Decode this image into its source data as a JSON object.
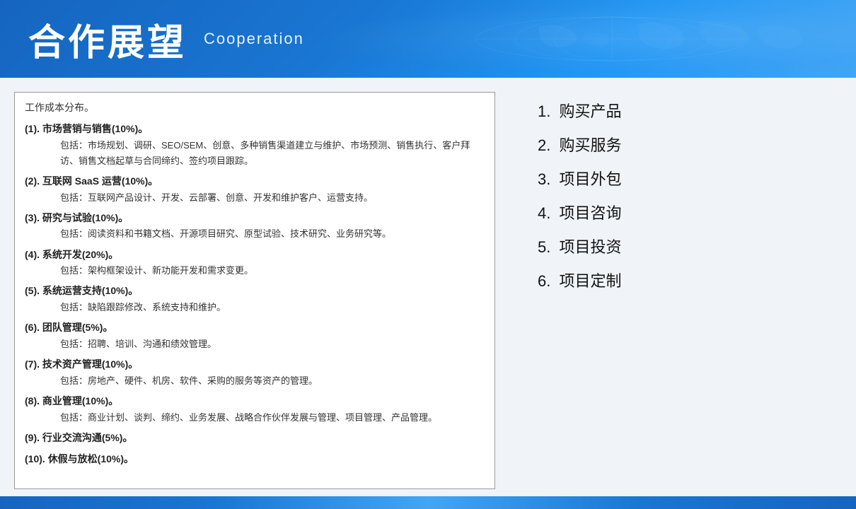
{
  "header": {
    "title_cn": "合作展望",
    "title_en": "Cooperation"
  },
  "content_box": {
    "header": "工作成本分布。",
    "sections": [
      {
        "id": "(1).",
        "title": "市场营销与销售(10%)。",
        "desc": "包括：市场规划、调研、SEO/SEM、创意、多种销售渠道建立与维护、市场预测、销售执行、客户拜访、销售文档起草与合同缔约、签约项目跟踪。"
      },
      {
        "id": "(2).",
        "title": "互联网 SaaS 运营(10%)。",
        "desc": "包括：互联网产品设计、开发、云部署、创意、开发和维护客户、运营支持。"
      },
      {
        "id": "(3).",
        "title": "研究与试验(10%)。",
        "desc": "包括：阅读资料和书籍文档、开源项目研究、原型试验、技术研究、业务研究等。"
      },
      {
        "id": "(4).",
        "title": "系统开发(20%)。",
        "desc": "包括：架构框架设计、新功能开发和需求变更。"
      },
      {
        "id": "(5).",
        "title": "系统运营支持(10%)。",
        "desc": "包括：缺陷跟踪修改、系统支持和维护。"
      },
      {
        "id": "(6).",
        "title": "团队管理(5%)。",
        "desc": "包括：招聘、培训、沟通和绩效管理。"
      },
      {
        "id": "(7).",
        "title": "技术资产管理(10%)。",
        "desc": "包括：房地产、硬件、机房、软件、采购的服务等资产的管理。"
      },
      {
        "id": "(8).",
        "title": "商业管理(10%)。",
        "desc": "包括：商业计划、谈判、缔约、业务发展、战略合作伙伴发展与管理、项目管理、产品管理。"
      },
      {
        "id": "(9).",
        "title": "行业交流沟通(5%)。",
        "desc": ""
      },
      {
        "id": "(10).",
        "title": "休假与放松(10%)。",
        "desc": ""
      }
    ]
  },
  "right_list": {
    "items": [
      "购买产品",
      "购买服务",
      "项目外包",
      "项目咨询",
      "项目投资",
      "项目定制"
    ]
  }
}
